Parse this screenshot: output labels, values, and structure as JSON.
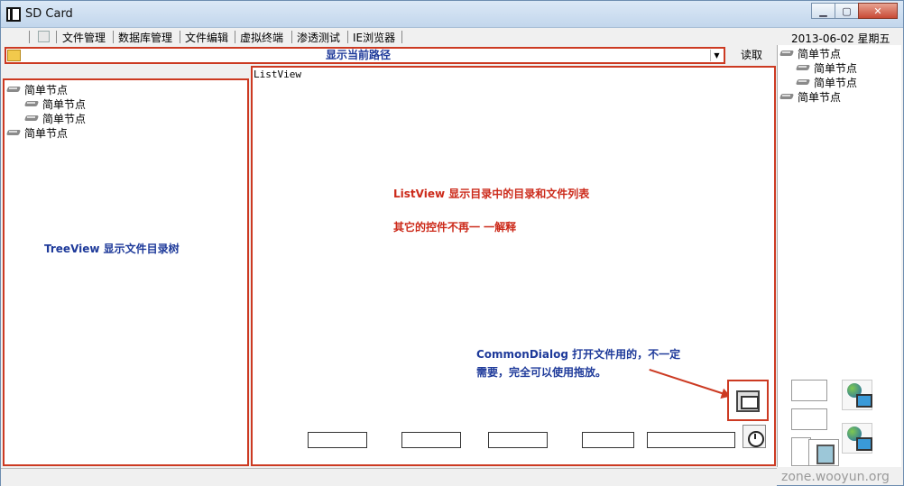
{
  "window": {
    "title": "SD Card"
  },
  "menu": {
    "items": [
      "文件管理",
      "数据库管理",
      "文件编辑",
      "虚拟终端",
      "渗透测试",
      "IE浏览器"
    ]
  },
  "status": {
    "date": "2013-06-02  星期五"
  },
  "path": {
    "label": "显示当前路径",
    "read_button": "读取"
  },
  "tree": {
    "nodes": [
      {
        "label": "简单节点",
        "level": 0
      },
      {
        "label": "简单节点",
        "level": 1
      },
      {
        "label": "简单节点",
        "level": 1
      },
      {
        "label": "简单节点",
        "level": 0
      }
    ],
    "caption": "TreeView 显示文件目录树"
  },
  "listview": {
    "label": "ListView",
    "caption1": "ListView 显示目录中的目录和文件列表",
    "caption2": "其它的控件不再一 一解释",
    "commondialog_caption": "CommonDialog 打开文件用的，不一定需要，完全可以使用拖放。"
  },
  "right_tree": {
    "nodes": [
      {
        "label": "简单节点",
        "level": 0
      },
      {
        "label": "简单节点",
        "level": 1
      },
      {
        "label": "简单节点",
        "level": 1
      },
      {
        "label": "简单节点",
        "level": 0
      }
    ]
  },
  "watermark": "zone.wooyun.org",
  "colors": {
    "annotation_red": "#cc3a22",
    "annotation_blue": "#1e3a9a"
  }
}
